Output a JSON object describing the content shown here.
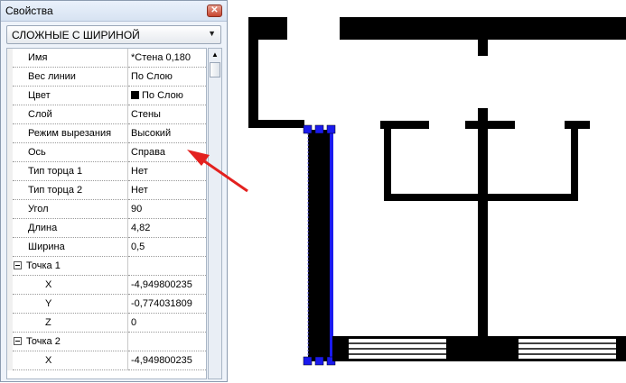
{
  "panel": {
    "title": "Свойства",
    "close_glyph": "✕",
    "category_select": {
      "value": "СЛОЖНЫЕ С ШИРИНОЙ",
      "arrow_icon": "chevron-down-icon"
    },
    "properties": [
      {
        "name": "Имя",
        "value": "*Стена 0,180"
      },
      {
        "name": "Вес линии",
        "value": "По Слою"
      },
      {
        "name": "Цвет",
        "value": "По Слою",
        "swatch_color": "#000000"
      },
      {
        "name": "Слой",
        "value": "Стены"
      },
      {
        "name": "Режим вырезания",
        "value": "Высокий"
      },
      {
        "name": "Ось",
        "value": "Справа"
      },
      {
        "name": "Тип торца 1",
        "value": "Нет"
      },
      {
        "name": "Тип торца 2",
        "value": "Нет"
      },
      {
        "name": "Угол",
        "value": "90"
      },
      {
        "name": "Длина",
        "value": "4,82"
      },
      {
        "name": "Ширина",
        "value": "0,5"
      }
    ],
    "point1": {
      "label": "Точка 1",
      "coords": [
        {
          "name": "X",
          "value": "-4,949800235"
        },
        {
          "name": "Y",
          "value": "-0,774031809"
        },
        {
          "name": "Z",
          "value": "0"
        }
      ]
    },
    "point2": {
      "label": "Точка 2",
      "coords": [
        {
          "name": "X",
          "value": "-4,949800235"
        }
      ]
    }
  },
  "annotation": {
    "arrow_color": "#e3211f",
    "points_to": "Ось"
  },
  "drawing": {
    "selection_color": "#1a1aee",
    "wall_color": "#000000"
  }
}
